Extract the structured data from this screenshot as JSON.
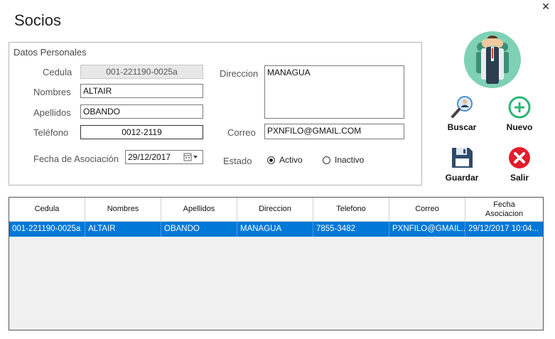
{
  "window": {
    "title": "Socios",
    "close_glyph": "×"
  },
  "datos_personales": {
    "group_title": "Datos Personales",
    "cedula_label": "Cedula",
    "cedula_value": "001-221190-0025a",
    "nombres_label": "Nombres",
    "nombres_value": "ALTAIR",
    "apellidos_label": "Apellidos",
    "apellidos_value": "OBANDO",
    "telefono_label": "Teléfono",
    "telefono_value": "0012-2119",
    "fecha_label": "Fecha de Asociación",
    "fecha_value": "29/12/2017",
    "direccion_label": "Direccion",
    "direccion_value": "MANAGUA",
    "correo_label": "Correo",
    "correo_value": "PXNFILO@GMAIL.COM",
    "estado_label": "Estado",
    "activo_label": "Activo",
    "inactivo_label": "Inactivo",
    "estado_selected": "Activo"
  },
  "toolbar": {
    "buscar_label": "Buscar",
    "nuevo_label": "Nuevo",
    "guardar_label": "Guardar",
    "salir_label": "Salir"
  },
  "icons": {
    "people": "people-icon",
    "buscar": "search-user-icon",
    "nuevo": "plus-circle-icon",
    "guardar": "floppy-disk-icon",
    "salir": "close-circle-icon"
  },
  "colors": {
    "selection": "#0078d7",
    "nuevo_green": "#2bb673",
    "salir_red": "#e31b2d",
    "people_bg": "#7fd1b5"
  },
  "table": {
    "headers": [
      "Cedula",
      "Nombres",
      "Apellidos",
      "Direccion",
      "Telefono",
      "Correo",
      "Fecha\nAsociacion"
    ],
    "rows": [
      [
        "001-221190-0025a",
        "ALTAIR",
        "OBANDO",
        "MANAGUA",
        "7855-3482",
        "PXNFILO@GMAIL...",
        "29/12/2017 10:04..."
      ]
    ]
  }
}
